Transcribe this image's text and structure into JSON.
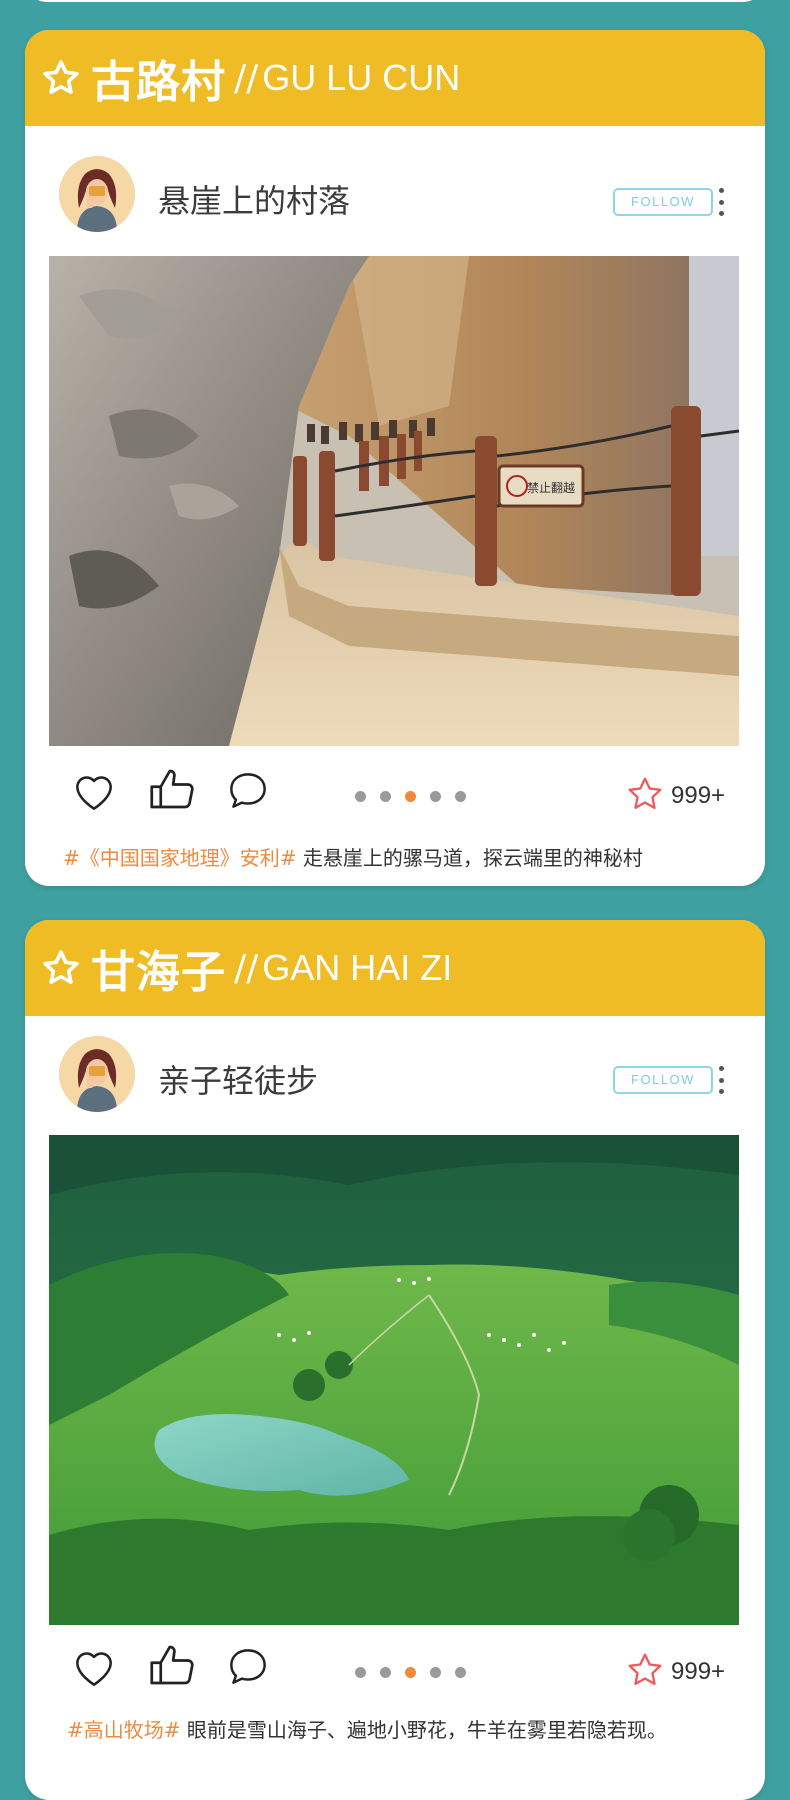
{
  "cards": [
    {
      "title_cn": "古路村",
      "title_sep": "//",
      "title_en": "GU LU CUN",
      "profile_name": "悬崖上的村落",
      "follow_label": "FOLLOW",
      "favorite_count": "999+",
      "active_slide": 3,
      "total_slides": 5,
      "caption_tag": "#《中国国家地理》安利#",
      "caption_text": " 走悬崖上的骡马道，探云端里的神秘村",
      "photo_sign_text": "禁止翻越"
    },
    {
      "title_cn": "甘海子",
      "title_sep": "//",
      "title_en": "GAN HAI ZI",
      "profile_name": "亲子轻徒步",
      "follow_label": "FOLLOW",
      "favorite_count": "999+",
      "active_slide": 3,
      "total_slides": 5,
      "caption_tag": "#高山牧场#",
      "caption_text": " 眼前是雪山海子、遍地小野花，牛羊在雾里若隐若现。"
    }
  ],
  "colors": {
    "background": "#3fa0a1",
    "header": "#f0bc25",
    "accent": "#ef8a3e",
    "follow": "#8fd4ea"
  },
  "icons": [
    "star-outline-icon",
    "heart-icon",
    "thumbs-up-icon",
    "comment-icon",
    "more-vertical-icon",
    "favorite-star-icon"
  ]
}
